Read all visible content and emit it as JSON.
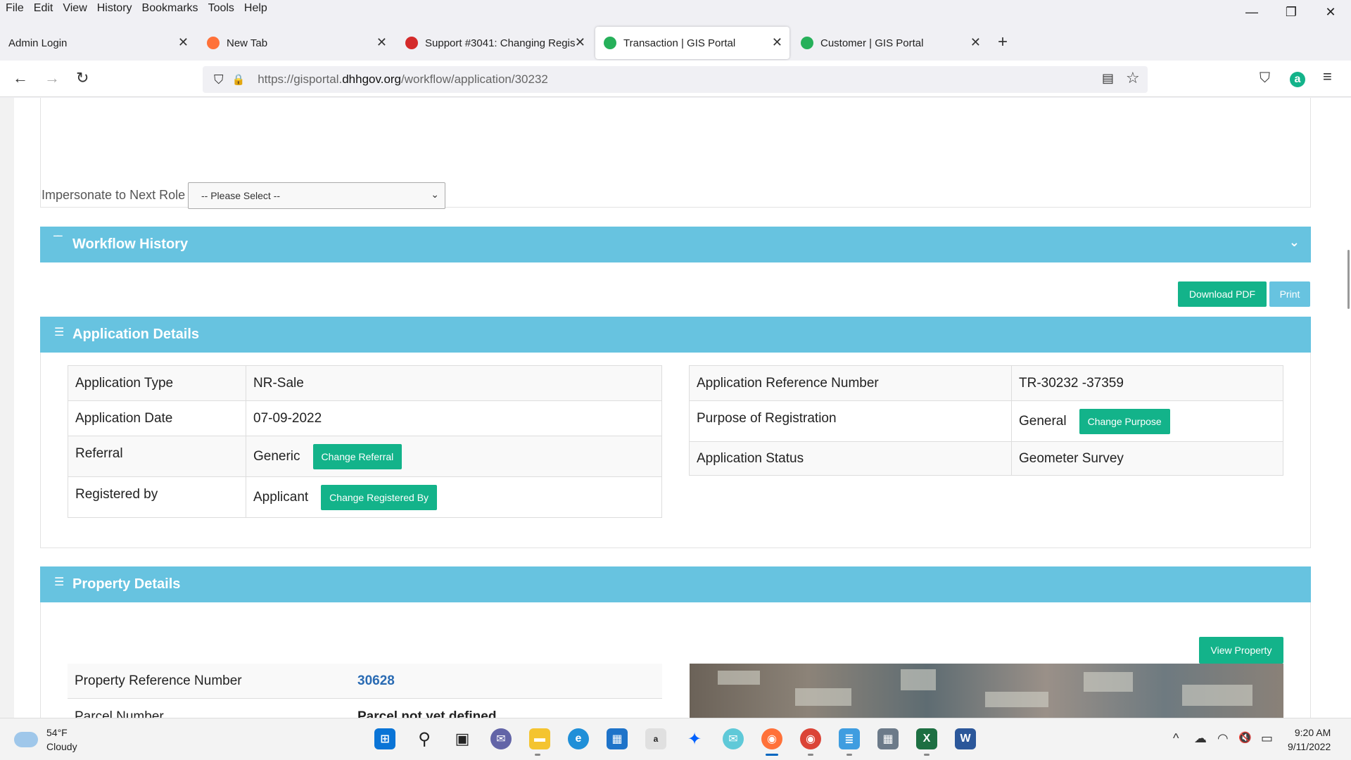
{
  "menubar": {
    "items": [
      "File",
      "Edit",
      "View",
      "History",
      "Bookmarks",
      "Tools",
      "Help"
    ]
  },
  "window_controls": {
    "minimize": "—",
    "restore": "❐",
    "close": "✕"
  },
  "tabs": [
    {
      "label": "Admin Login",
      "icon_color": ""
    },
    {
      "label": "New Tab",
      "icon_color": "#ff7139"
    },
    {
      "label": "Support #3041: Changing Regis",
      "icon_color": "#d42a2a"
    },
    {
      "label": "Transaction | GIS Portal",
      "icon_color": "#26b05a"
    },
    {
      "label": "Customer | GIS Portal",
      "icon_color": "#26b05a"
    }
  ],
  "tab_close": "✕",
  "new_tab": "+",
  "nav": {
    "back": "←",
    "forward": "→",
    "reload": "↻",
    "shield": "⛉",
    "lock": "🔒",
    "reader": "▤",
    "star": "☆",
    "pocket": "⛉",
    "menu": "≡",
    "account_initial": "a"
  },
  "url": {
    "prefix": "https://gisportal.",
    "host": "dhhgov.org",
    "path": "/workflow/application/30232"
  },
  "impersonate": {
    "label": "Impersonate to Next Role",
    "selected": "-- Please Select --",
    "chevron": "⌄"
  },
  "workflow_history": {
    "title": "Workflow History",
    "icon": "‾‾",
    "chevron": "⌄"
  },
  "actions": {
    "download_pdf": "Download PDF",
    "print": "Print"
  },
  "application_details": {
    "title": "Application Details",
    "icon": "☰",
    "left": [
      {
        "label": "Application Type",
        "value": "NR-Sale",
        "button": ""
      },
      {
        "label": "Application Date",
        "value": "07-09-2022",
        "button": ""
      },
      {
        "label": "Referral",
        "value": "Generic",
        "button": "Change Referral"
      },
      {
        "label": "Registered by",
        "value": "Applicant",
        "button": "Change Registered By"
      }
    ],
    "right": [
      {
        "label": "Application Reference Number",
        "value": "TR-30232 -37359",
        "button": ""
      },
      {
        "label": "Purpose of Registration",
        "value": "General",
        "button": "Change Purpose"
      },
      {
        "label": "Application Status",
        "value": "Geometer Survey",
        "button": ""
      }
    ]
  },
  "property_details": {
    "title": "Property Details",
    "icon": "☰",
    "view_button": "View Property",
    "rows": [
      {
        "label": "Property Reference Number",
        "value": "30628"
      },
      {
        "label": "Parcel Number",
        "value": "Parcel not yet defined"
      }
    ]
  },
  "taskbar": {
    "weather": {
      "temp": "54°F",
      "condition": "Cloudy"
    },
    "apps": [
      {
        "name": "windows-start",
        "glyph": "⊞",
        "color": "#0a74d6"
      },
      {
        "name": "search",
        "glyph": "⚲",
        "color": "#222"
      },
      {
        "name": "task-view",
        "glyph": "▣",
        "color": "#222"
      },
      {
        "name": "teams-chat",
        "glyph": "✉",
        "color": "#6264a7"
      },
      {
        "name": "file-explorer",
        "glyph": "▬",
        "color": "#f4c430"
      },
      {
        "name": "edge",
        "glyph": "e",
        "color": "#1f8fd8"
      },
      {
        "name": "store",
        "glyph": "▦",
        "color": "#1e73c9"
      },
      {
        "name": "amazon",
        "glyph": "a",
        "color": "#e0e0e0"
      },
      {
        "name": "dropbox",
        "glyph": "✦",
        "color": "#0061fe"
      },
      {
        "name": "mail-app",
        "glyph": "✉",
        "color": "#5fc9d8"
      },
      {
        "name": "firefox",
        "glyph": "◉",
        "color": "#ff7139"
      },
      {
        "name": "chrome",
        "glyph": "◉",
        "color": "#db4437"
      },
      {
        "name": "notepad",
        "glyph": "≣",
        "color": "#3f9de0"
      },
      {
        "name": "calculator",
        "glyph": "▦",
        "color": "#6c7a89"
      },
      {
        "name": "excel",
        "glyph": "X",
        "color": "#1d6f42"
      },
      {
        "name": "word",
        "glyph": "W",
        "color": "#2b579a"
      }
    ],
    "tray": {
      "chevron": "^",
      "cloud": "☁",
      "wifi": "◠",
      "volume": "🔇",
      "battery": "▭"
    },
    "time": "9:20 AM",
    "date": "9/11/2022"
  }
}
